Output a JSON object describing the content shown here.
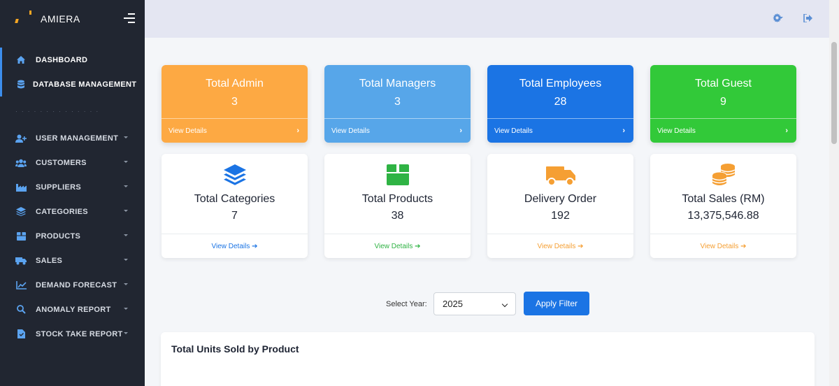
{
  "brand": {
    "name": "AMIERA"
  },
  "sidebar": {
    "items": [
      {
        "label": "DASHBOARD",
        "icon": "home-icon"
      },
      {
        "label": "DATABASE MANAGEMENT",
        "icon": "database-icon"
      },
      {
        "label": "USER MANAGEMENT",
        "icon": "user-plus-icon"
      },
      {
        "label": "CUSTOMERS",
        "icon": "users-icon"
      },
      {
        "label": "SUPPLIERS",
        "icon": "industry-icon"
      },
      {
        "label": "CATEGORIES",
        "icon": "layers-icon"
      },
      {
        "label": "PRODUCTS",
        "icon": "box-icon"
      },
      {
        "label": "SALES",
        "icon": "truck-icon"
      },
      {
        "label": "DEMAND FORECAST",
        "icon": "chart-line-icon"
      },
      {
        "label": "ANOMALY REPORT",
        "icon": "search-icon"
      },
      {
        "label": "STOCK TAKE REPORT",
        "icon": "file-icon"
      }
    ]
  },
  "summary_cards": [
    {
      "title": "Total Admin",
      "value": "3",
      "link": "View Details",
      "color": "#fda943"
    },
    {
      "title": "Total Managers",
      "value": "3",
      "link": "View Details",
      "color": "#57a6e9"
    },
    {
      "title": "Total Employees",
      "value": "28",
      "link": "View Details",
      "color": "#1b74e4"
    },
    {
      "title": "Total Guest",
      "value": "9",
      "link": "View Details",
      "color": "#32c939"
    }
  ],
  "stat_cards": [
    {
      "title": "Total Categories",
      "value": "7",
      "link": "View Details",
      "icon": "layers-icon",
      "color": "#1b74e4"
    },
    {
      "title": "Total Products",
      "value": "38",
      "link": "View Details",
      "icon": "box-icon",
      "color": "#2fb344"
    },
    {
      "title": "Delivery Order",
      "value": "192",
      "link": "View Details",
      "icon": "truck-icon",
      "color": "#f59f33"
    },
    {
      "title": "Total Sales (RM)",
      "value": "13,375,546.88",
      "link": "View Details",
      "icon": "coins-icon",
      "color": "#f59f33"
    }
  ],
  "filter": {
    "label": "Select Year:",
    "selected_year": "2025",
    "apply_label": "Apply Filter"
  },
  "chart": {
    "title": "Total Units Sold by Product"
  }
}
